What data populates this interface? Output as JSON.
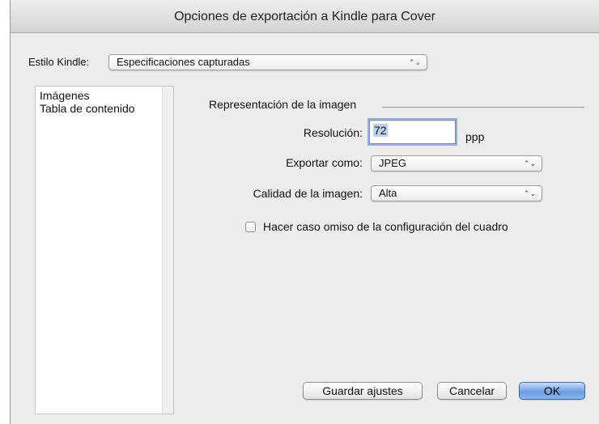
{
  "window": {
    "title": "Opciones de exportación a Kindle para Cover"
  },
  "kindle_style": {
    "label": "Estilo Kindle:",
    "value": "Especificaciones capturadas",
    "arrows": "⌃⌄"
  },
  "categories": [
    "Imágenes",
    "Tabla de contenido"
  ],
  "image_rendering": {
    "section_title": "Representación de la imagen",
    "resolution": {
      "label": "Resolución:",
      "value": "72",
      "unit": "ppp"
    },
    "export_as": {
      "label": "Exportar como:",
      "value": "JPEG"
    },
    "quality": {
      "label": "Calidad de la imagen:",
      "value": "Alta"
    },
    "ignore_frame": {
      "label": "Hacer caso omiso de la configuración del cuadro",
      "checked": false
    }
  },
  "buttons": {
    "save": "Guardar ajustes",
    "cancel": "Cancelar",
    "ok": "OK"
  },
  "colors": {
    "default_button": "#6c9ee3",
    "focus_ring": "#8ab2e6",
    "window_bg": "#ececec"
  }
}
